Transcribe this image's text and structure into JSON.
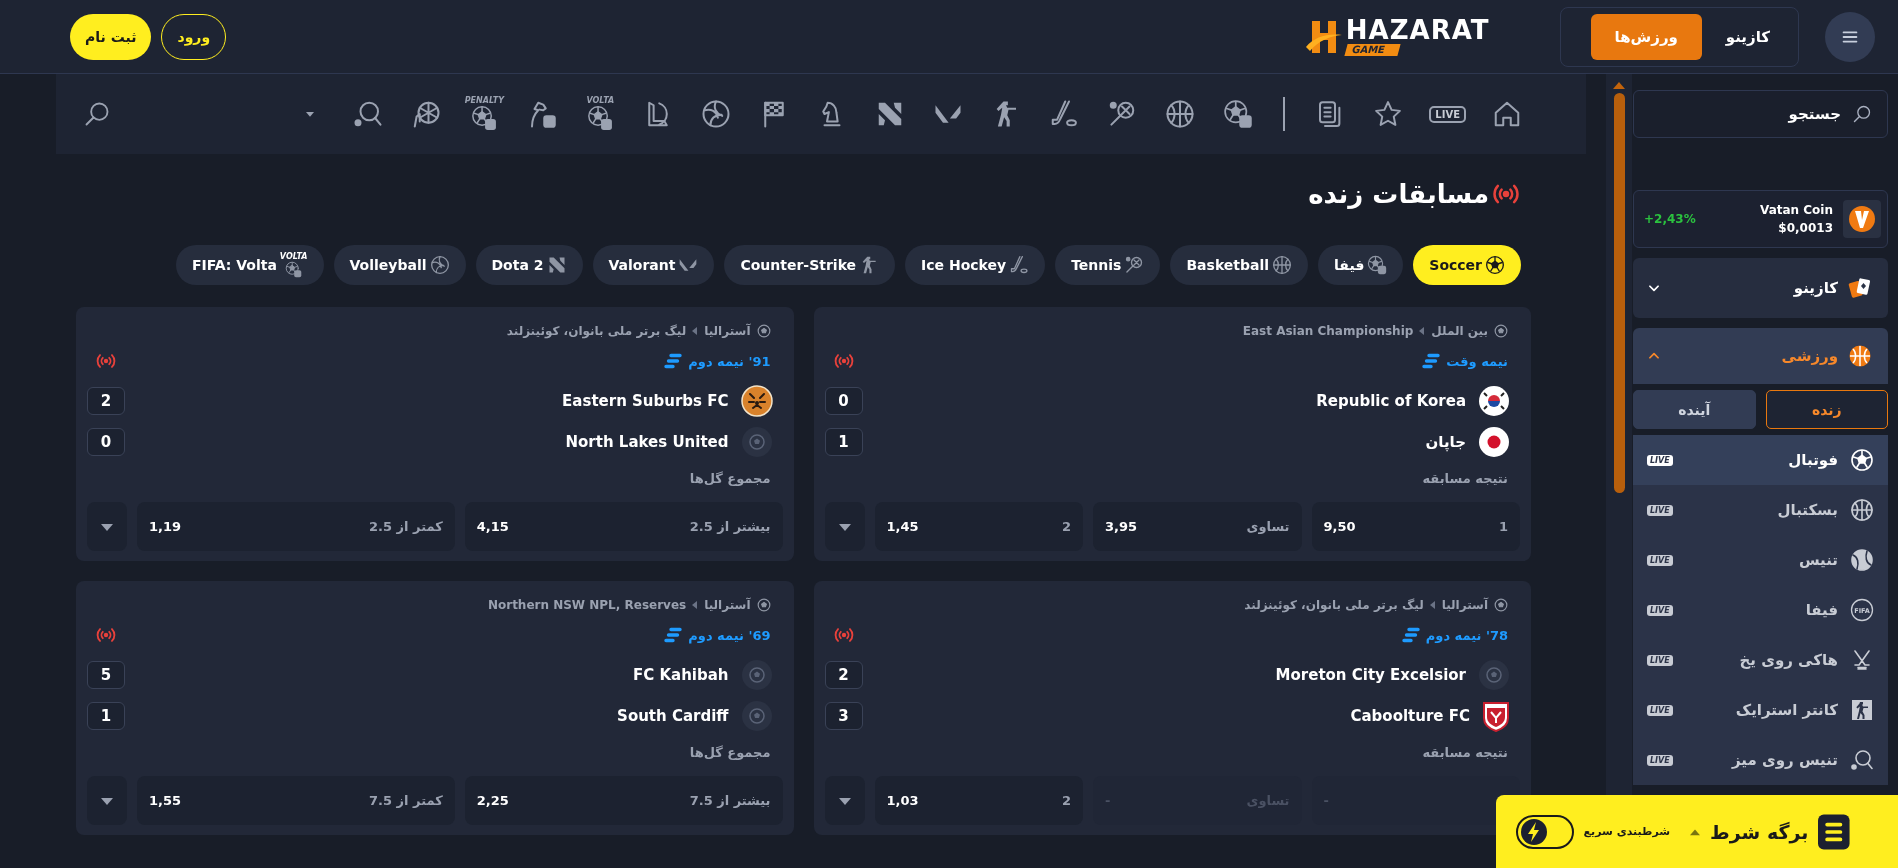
{
  "header": {
    "section_tabs": [
      {
        "label": "کازینو",
        "selected": false
      },
      {
        "label": "ورزش‌ها",
        "selected": true
      }
    ],
    "logo": {
      "title": "HAZARAT",
      "subtitle": "GAME"
    },
    "auth_buttons": [
      {
        "label": "ورود",
        "kind": "outline"
      },
      {
        "label": "ثبت نام",
        "kind": "filled"
      }
    ]
  },
  "sport_bar": {
    "items": [
      {
        "kind": "home"
      },
      {
        "kind": "live",
        "label": "LIVE"
      },
      {
        "kind": "star"
      },
      {
        "kind": "slip"
      },
      {
        "kind": "divider"
      },
      {
        "kind": "soccer-bot"
      },
      {
        "kind": "basketball"
      },
      {
        "kind": "tennis"
      },
      {
        "kind": "hockey"
      },
      {
        "kind": "shooter"
      },
      {
        "kind": "valorant"
      },
      {
        "kind": "dota"
      },
      {
        "kind": "chess"
      },
      {
        "kind": "flag"
      },
      {
        "kind": "volleyball"
      },
      {
        "kind": "lol"
      },
      {
        "kind": "soccer-bot",
        "tag": "VOLTA"
      },
      {
        "kind": "horse-bot"
      },
      {
        "kind": "soccer-bot",
        "tag": "PENALTY"
      },
      {
        "kind": "handball"
      },
      {
        "kind": "table-tennis"
      },
      {
        "kind": "caret"
      }
    ]
  },
  "title": "مسابقات زنده",
  "sport_chips": [
    {
      "label": "Soccer",
      "kind": "soccer",
      "selected": true
    },
    {
      "label": "فیفا",
      "kind": "soccer-bot",
      "selected": false
    },
    {
      "label": "Basketball",
      "kind": "basketball",
      "selected": false
    },
    {
      "label": "Tennis",
      "kind": "tennis",
      "selected": false
    },
    {
      "label": "Ice Hockey",
      "kind": "hockey",
      "selected": false
    },
    {
      "label": "Counter-Strike",
      "kind": "shooter",
      "selected": false
    },
    {
      "label": "Valorant",
      "kind": "valorant",
      "selected": false
    },
    {
      "label": "Dota 2",
      "kind": "dota",
      "selected": false
    },
    {
      "label": "Volleyball",
      "kind": "volleyball",
      "selected": false
    },
    {
      "label": "FIFA: Volta",
      "kind": "soccer-bot",
      "tag": "VOLTA",
      "selected": false
    }
  ],
  "matches": [
    {
      "country": "بین الملل",
      "league": "East Asian Championship",
      "time": "نیمه وقت",
      "teams": [
        {
          "name": "Republic of Korea",
          "score": "0",
          "kind": "korea"
        },
        {
          "name": "جاپان",
          "score": "1",
          "kind": "japan"
        }
      ],
      "market": "نتیجه مسابقه",
      "odds": [
        {
          "label": "1",
          "value": "9,50",
          "disabled": false
        },
        {
          "label": "تساوی",
          "value": "3,95",
          "disabled": false
        },
        {
          "label": "2",
          "value": "1,45",
          "disabled": false
        }
      ]
    },
    {
      "country": "آسترالیا",
      "league": "لیگ برتر ملی بانوان، کوئینزلند",
      "time": "91' نیمه دوم",
      "teams": [
        {
          "name": "Eastern Suburbs FC",
          "score": "2",
          "kind": "tiger"
        },
        {
          "name": "North Lakes United",
          "score": "0",
          "kind": "generic"
        }
      ],
      "market": "مجموع گل‌ها",
      "odds": [
        {
          "label": "بیشتر از 2.5",
          "value": "4,15",
          "disabled": false
        },
        {
          "label": "کمتر از 2.5",
          "value": "1,19",
          "disabled": false
        }
      ]
    },
    {
      "country": "آسترالیا",
      "league": "لیگ برتر ملی بانوان، کوئینزلند",
      "time": "78' نیمه دوم",
      "teams": [
        {
          "name": "Moreton City Excelsior",
          "score": "2",
          "kind": "generic"
        },
        {
          "name": "Caboolture FC",
          "score": "3",
          "kind": "crest"
        }
      ],
      "market": "نتیجه مسابقه",
      "odds": [
        {
          "value": "-",
          "disabled": true
        },
        {
          "label": "تساوی",
          "value": "-",
          "disabled": true
        },
        {
          "label": "2",
          "value": "1,03",
          "disabled": false
        }
      ]
    },
    {
      "country": "آسترالیا",
      "league": "Northern NSW NPL, Reserves",
      "time": "69' نیمه دوم",
      "teams": [
        {
          "name": "FC Kahibah",
          "score": "5",
          "kind": "generic"
        },
        {
          "name": "South Cardiff",
          "score": "1",
          "kind": "generic"
        }
      ],
      "market": "مجموع گل‌ها",
      "odds": [
        {
          "label": "بیشتر از 7.5",
          "value": "2,25",
          "disabled": false
        },
        {
          "label": "کمتر از 7.5",
          "value": "1,55",
          "disabled": false
        }
      ]
    }
  ],
  "sidebar": {
    "search": {
      "placeholder": "جستجو"
    },
    "coin": {
      "name": "Vatan Coin",
      "price": "$0,0013",
      "change": "+2,43%"
    },
    "menu": [
      {
        "label": "کازینو",
        "kind": "casino",
        "expanded": false
      },
      {
        "label": "ورزشی",
        "kind": "sports",
        "expanded": true,
        "tabs": [
          {
            "label": "زنده",
            "selected": true
          },
          {
            "label": "آینده",
            "selected": false
          }
        ],
        "items": [
          {
            "label": "فوتبال",
            "kind": "soccer",
            "badge": "LIVE",
            "selected": true
          },
          {
            "label": "بسکتبال",
            "kind": "basketball",
            "badge": "LIVE",
            "selected": false
          },
          {
            "label": "تنیس",
            "kind": "tennis-ball",
            "badge": "LIVE",
            "selected": false
          },
          {
            "label": "فیفا",
            "kind": "fifa",
            "tag": "FIFA",
            "badge": "LIVE",
            "selected": false
          },
          {
            "label": "هاکی روی یخ",
            "kind": "crossed-sticks",
            "badge": "LIVE",
            "selected": false
          },
          {
            "label": "کانتر استرایک",
            "kind": "shooter-box",
            "badge": "LIVE",
            "selected": false
          },
          {
            "label": "تنیس روی میز",
            "kind": "table-tennis",
            "badge": "LIVE",
            "selected": false
          }
        ]
      }
    ]
  },
  "bet_slip": {
    "title": "برگه شرط",
    "quick_bet": {
      "label": "شرطبندی سریع",
      "on": false
    }
  }
}
